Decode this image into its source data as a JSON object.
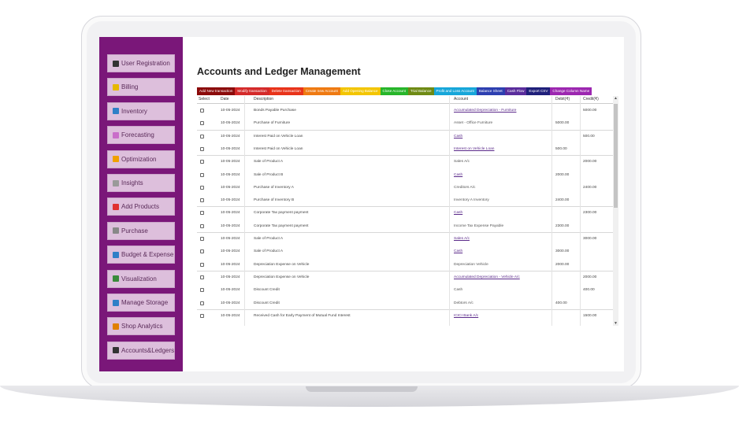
{
  "app": {
    "title": "Accounts and Ledger Management"
  },
  "sidebar": {
    "items": [
      {
        "label": "User Registration",
        "icon": "user-icon",
        "color": "#333333"
      },
      {
        "label": "Billing",
        "icon": "billing-icon",
        "color": "#e6b800"
      },
      {
        "label": "Inventory",
        "icon": "inventory-icon",
        "color": "#2f7fc7"
      },
      {
        "label": "Forecasting",
        "icon": "chart-line-icon",
        "color": "#c96ec9"
      },
      {
        "label": "Optimization",
        "icon": "lightbulb-icon",
        "color": "#f0a000"
      },
      {
        "label": "Insights",
        "icon": "insights-icon",
        "color": "#9a9a9a"
      },
      {
        "label": "Add Products",
        "icon": "arrow-right-icon",
        "color": "#e03030"
      },
      {
        "label": "Purchase",
        "icon": "cart-icon",
        "color": "#888888"
      },
      {
        "label": "Budget & Expense",
        "icon": "budget-icon",
        "color": "#2f7fc7"
      },
      {
        "label": "Visualization",
        "icon": "bar-chart-icon",
        "color": "#3a8a3a"
      },
      {
        "label": "Manage Storage",
        "icon": "storage-icon",
        "color": "#2f7fc7"
      },
      {
        "label": "Shop Analytics",
        "icon": "analytics-icon",
        "color": "#e08000"
      },
      {
        "label": "Accounts&Ledgers",
        "icon": "ledger-icon",
        "color": "#333333"
      }
    ]
  },
  "tabs": [
    {
      "label": "Add New transaction",
      "color": "#8b0a0a"
    },
    {
      "label": "Modify transaction",
      "color": "#d42a2a"
    },
    {
      "label": "Delete transaction",
      "color": "#e8331a"
    },
    {
      "label": "Create new Account",
      "color": "#ef7a12"
    },
    {
      "label": "Add Opening Balance",
      "color": "#f3c500"
    },
    {
      "label": "Close Account",
      "color": "#27b52a"
    },
    {
      "label": "Trial Balance",
      "color": "#6e8a14"
    },
    {
      "label": "Profit and Loss Account",
      "color": "#17a6d9"
    },
    {
      "label": "Balance Sheet",
      "color": "#2d3fb0"
    },
    {
      "label": "Cash Flow",
      "color": "#5a2d9c"
    },
    {
      "label": "Export CSV",
      "color": "#1f1f7a"
    },
    {
      "label": "Change Column Name",
      "color": "#9c27b0"
    }
  ],
  "table": {
    "headers": {
      "select": "Select",
      "date": "Date",
      "description": "Description",
      "account": "Account",
      "debit": "Debit(₹)",
      "credit": "Credit(₹)"
    },
    "rows": [
      {
        "date": "10-05-2024",
        "description": "Bonds Payable Purchase",
        "account": "Accumulated Depreciation - Furniture",
        "account_link": true,
        "debit": "",
        "credit": "5000.00"
      },
      {
        "date": "10-05-2024",
        "description": "Purchase of Furniture",
        "account": "Asset - Office Furniture",
        "account_link": false,
        "debit": "5000.00",
        "credit": ""
      },
      {
        "date": "10-05-2024",
        "description": "Interest Paid on Vehicle Loan",
        "account": "Cash",
        "account_link": true,
        "debit": "",
        "credit": "500.00"
      },
      {
        "date": "10-05-2024",
        "description": "Interest Paid on Vehicle Loan",
        "account": "Interest on Vehicle Loan",
        "account_link": true,
        "debit": "500.00",
        "credit": ""
      },
      {
        "date": "10-05-2024",
        "description": "Sale of Product A",
        "account": "Sales A/c",
        "account_link": false,
        "debit": "",
        "credit": "2000.00"
      },
      {
        "date": "10-05-2024",
        "description": "Sale of Product B",
        "account": "Cash",
        "account_link": true,
        "debit": "2000.00",
        "credit": ""
      },
      {
        "date": "10-05-2024",
        "description": "Purchase of Inventory A",
        "account": "Creditors A/c",
        "account_link": false,
        "debit": "",
        "credit": "2400.00"
      },
      {
        "date": "10-05-2024",
        "description": "Purchase of Inventory B",
        "account": "Inventory A Inventory",
        "account_link": false,
        "debit": "2400.00",
        "credit": ""
      },
      {
        "date": "10-05-2024",
        "description": "Corporate Tax payment payment",
        "account": "Cash",
        "account_link": true,
        "debit": "",
        "credit": "2300.00"
      },
      {
        "date": "10-05-2024",
        "description": "Corporate Tax payment payment",
        "account": "Income Tax Expense Payable",
        "account_link": false,
        "debit": "2300.00",
        "credit": ""
      },
      {
        "date": "10-05-2024",
        "description": "Sale of Product A",
        "account": "Sales A/c",
        "account_link": true,
        "debit": "",
        "credit": "3000.00"
      },
      {
        "date": "10-05-2024",
        "description": "Sale of Product A",
        "account": "Cash",
        "account_link": true,
        "debit": "3000.00",
        "credit": ""
      },
      {
        "date": "10-05-2024",
        "description": "Depreciation Expense on Vehicle",
        "account": "Depreciation Vehicle",
        "account_link": false,
        "debit": "2000.00",
        "credit": ""
      },
      {
        "date": "10-05-2024",
        "description": "Depreciation Expense on Vehicle",
        "account": "Accumulated Depreciation - Vehicle A/c",
        "account_link": true,
        "debit": "",
        "credit": "2000.00"
      },
      {
        "date": "10-05-2024",
        "description": "Discount Credit",
        "account": "Cash",
        "account_link": false,
        "debit": "",
        "credit": "400.00"
      },
      {
        "date": "10-05-2024",
        "description": "Discount Credit",
        "account": "Debtors A/c",
        "account_link": false,
        "debit": "400.00",
        "credit": ""
      },
      {
        "date": "10-05-2024",
        "description": "Received Cash for Early Payment of Mutual Fund Interest",
        "account": "ICICI Bank A/c",
        "account_link": true,
        "debit": "",
        "credit": "1500.00"
      }
    ]
  }
}
